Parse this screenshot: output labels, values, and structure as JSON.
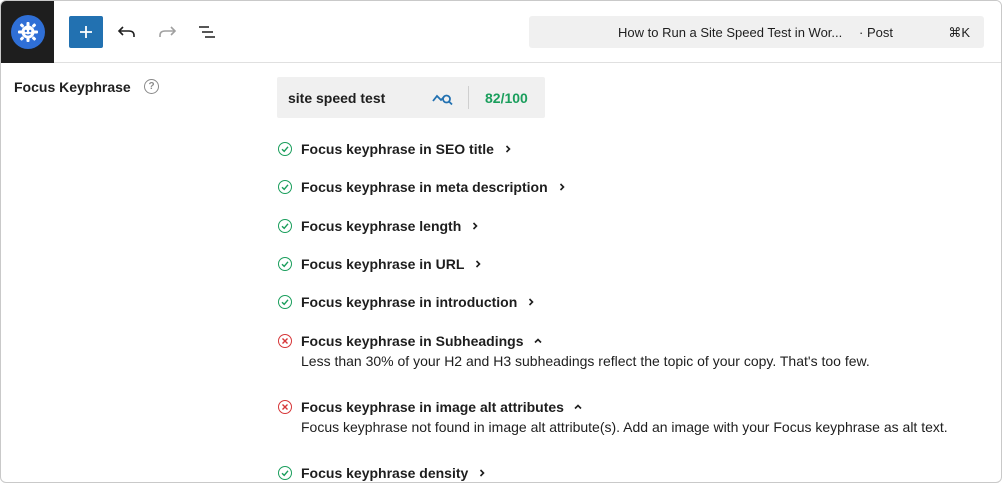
{
  "colors": {
    "accent": "#2271b1",
    "good": "#1a9e5c",
    "bad": "#d63638",
    "logo_bg": "#1e1e1e",
    "logo_circle": "#2f6fd6"
  },
  "toolbar": {
    "add_icon": "plus-icon",
    "undo_icon": "undo-icon",
    "redo_icon": "redo-icon",
    "list_view_icon": "list-view-icon"
  },
  "command_bar": {
    "title": "How to Run a Site Speed Test in Wor...",
    "type": "· Post",
    "shortcut": "⌘K"
  },
  "panel": {
    "label": "Focus Keyphrase",
    "help_icon": "?",
    "keyphrase": "site speed test",
    "score": "82/100"
  },
  "checks": [
    {
      "label": "Focus keyphrase in SEO title",
      "status": "good",
      "expanded": false
    },
    {
      "label": "Focus keyphrase in meta description",
      "status": "good",
      "expanded": false
    },
    {
      "label": "Focus keyphrase length",
      "status": "good",
      "expanded": false
    },
    {
      "label": "Focus keyphrase in URL",
      "status": "good",
      "expanded": false
    },
    {
      "label": "Focus keyphrase in introduction",
      "status": "good",
      "expanded": false
    },
    {
      "label": "Focus keyphrase in Subheadings",
      "status": "bad",
      "expanded": true,
      "description": "Less than 30% of your H2 and H3 subheadings reflect the topic of your copy. That's too few."
    },
    {
      "label": "Focus keyphrase in image alt attributes",
      "status": "bad",
      "expanded": true,
      "description": "Focus keyphrase not found in image alt attribute(s). Add an image with your Focus keyphrase as alt text."
    },
    {
      "label": "Focus keyphrase density",
      "status": "good",
      "expanded": false
    }
  ]
}
